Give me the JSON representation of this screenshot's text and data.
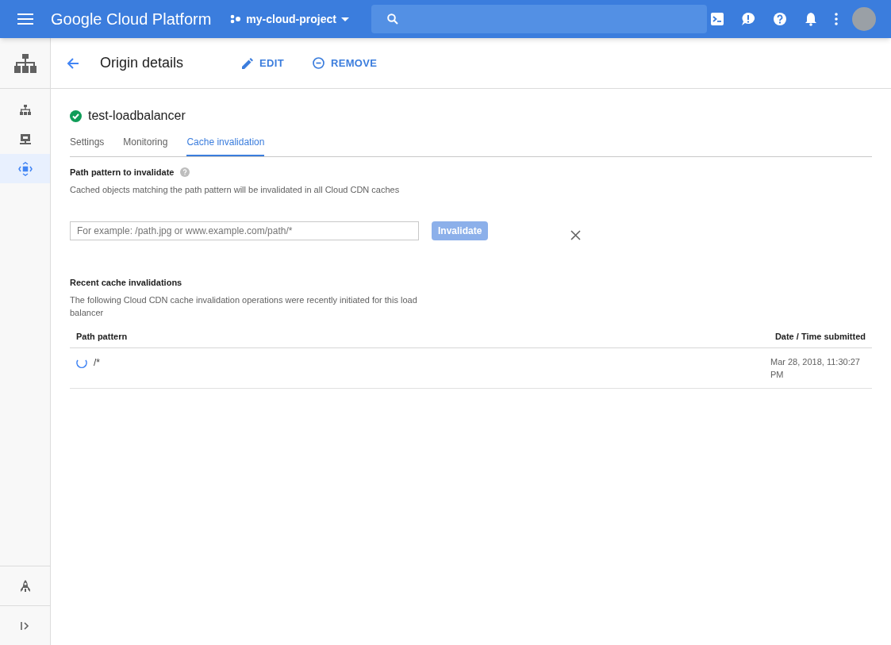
{
  "topbar": {
    "product": "Google Cloud Platform",
    "project": "my-cloud-project"
  },
  "sidebar": {
    "items": [
      {
        "kind": "network",
        "selected": false
      },
      {
        "kind": "server",
        "selected": false
      },
      {
        "kind": "cdn",
        "selected": true
      }
    ]
  },
  "header": {
    "title": "Origin details",
    "actions": [
      {
        "kind": "edit",
        "label": "EDIT"
      },
      {
        "kind": "remove",
        "label": "REMOVE"
      }
    ]
  },
  "origin": {
    "name": "test-loadbalancer",
    "healthy": true
  },
  "tabs": [
    {
      "label": "Settings",
      "selected": false
    },
    {
      "label": "Monitoring",
      "selected": false
    },
    {
      "label": "Cache invalidation",
      "selected": true
    }
  ],
  "invalidate": {
    "heading": "Path pattern to invalidate",
    "description": "Cached objects matching the path pattern will be invalidated in all Cloud CDN caches",
    "placeholder": "For example: /path.jpg or www.example.com/path/*",
    "button": {
      "label": "Invalidate",
      "disabled": true
    }
  },
  "recent": {
    "heading": "Recent cache invalidations",
    "description": "The following Cloud CDN cache invalidation operations were recently initiated for this load balancer"
  },
  "table": {
    "columns": [
      "Path pattern",
      "Date / Time submitted"
    ],
    "rows": [
      {
        "in_progress": true,
        "path": "/*",
        "submitted": "Mar 28, 2018, 11:30:27 PM"
      }
    ]
  }
}
